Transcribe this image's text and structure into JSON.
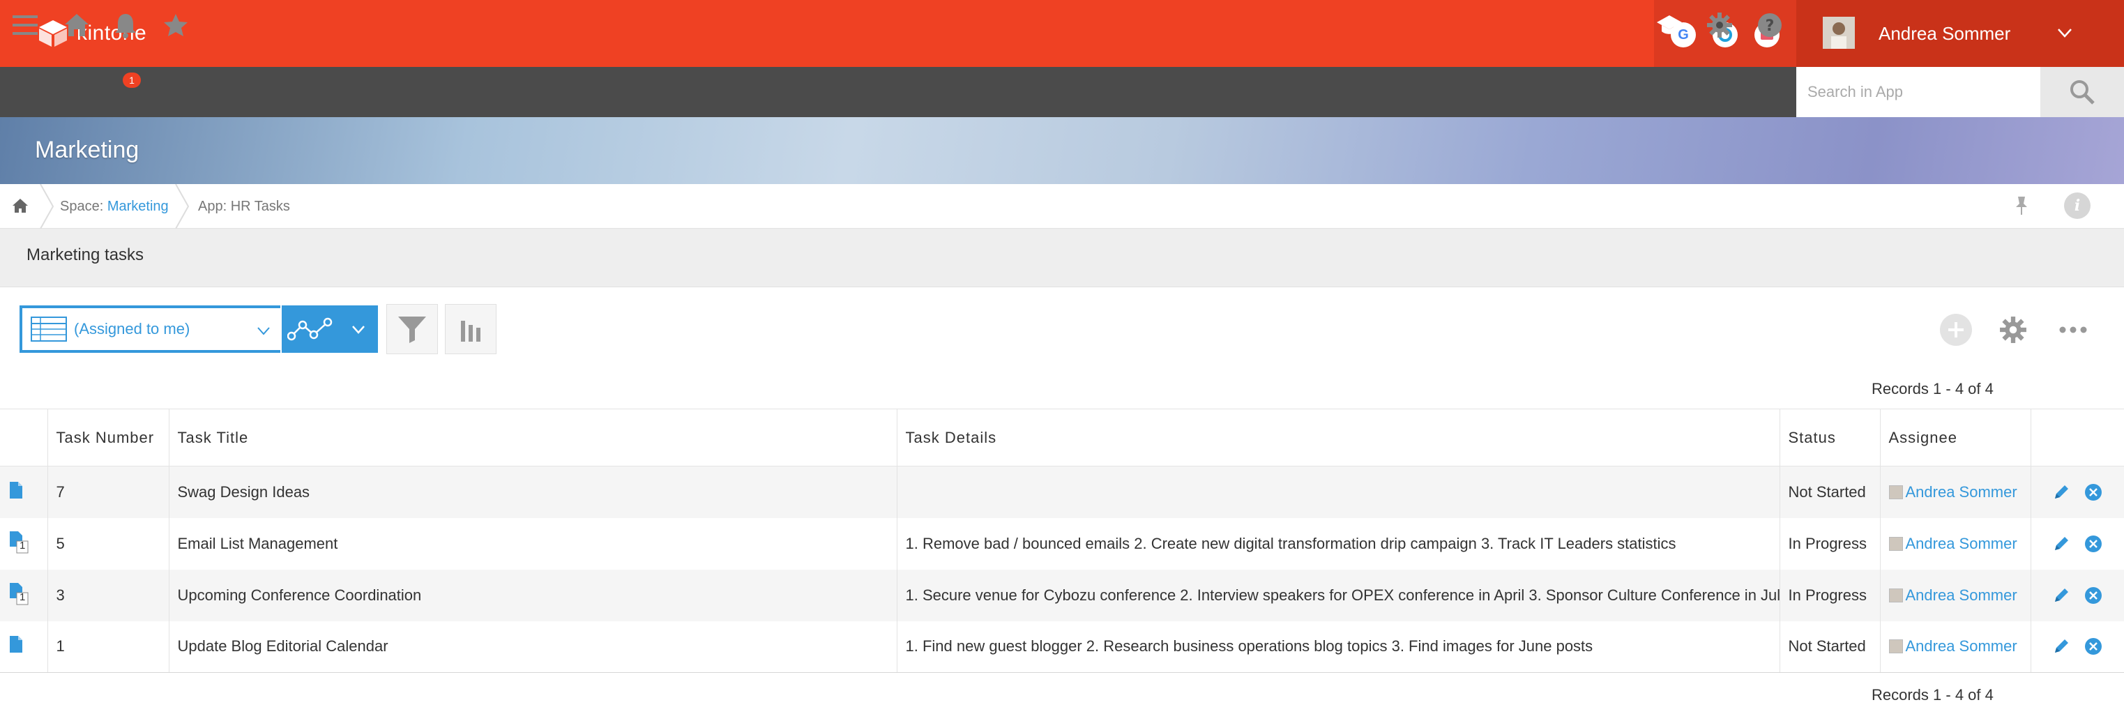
{
  "header": {
    "app_name": "kintone",
    "user_name": "Andrea Sommer",
    "integrations": [
      "google-icon",
      "garoon-icon",
      "mail-icon"
    ]
  },
  "toolbar": {
    "notification_count": "1",
    "search_placeholder": "Search in App"
  },
  "banner": {
    "title": "Marketing"
  },
  "breadcrumb": {
    "space_prefix": "Space:",
    "space_name": "Marketing",
    "app_label": "App: HR Tasks"
  },
  "section": {
    "title": "Marketing tasks"
  },
  "view": {
    "selected": "(Assigned to me)"
  },
  "records": {
    "count_top": "Records 1 - 4 of 4",
    "count_bottom": "Records 1 - 4 of 4"
  },
  "table": {
    "columns": [
      "Task Number",
      "Task Title",
      "Task Details",
      "Status",
      "Assignee"
    ],
    "rows": [
      {
        "number": "7",
        "title": "Swag Design Ideas",
        "details": "",
        "status": "Not Started",
        "assignee": "Andrea Sommer",
        "badge": ""
      },
      {
        "number": "5",
        "title": "Email List Management",
        "details": "1. Remove bad / bounced emails 2. Create new digital transformation drip campaign 3. Track IT Leaders statistics",
        "status": "In Progress",
        "assignee": "Andrea Sommer",
        "badge": "1"
      },
      {
        "number": "3",
        "title": "Upcoming Conference Coordination",
        "details": "1. Secure venue for Cybozu conference 2. Interview speakers for OPEX conference in April 3. Sponsor Culture Conference in July",
        "status": "In Progress",
        "assignee": "Andrea Sommer",
        "badge": "1"
      },
      {
        "number": "1",
        "title": "Update Blog Editorial Calendar",
        "details": "1. Find new guest blogger  2. Research business operations blog topics 3. Find images for June posts",
        "status": "Not Started",
        "assignee": "Andrea Sommer",
        "badge": ""
      }
    ]
  },
  "colors": {
    "header_red": "#ef4123",
    "toolbar_dark": "#4b4b4b",
    "accent_blue": "#3498db"
  }
}
